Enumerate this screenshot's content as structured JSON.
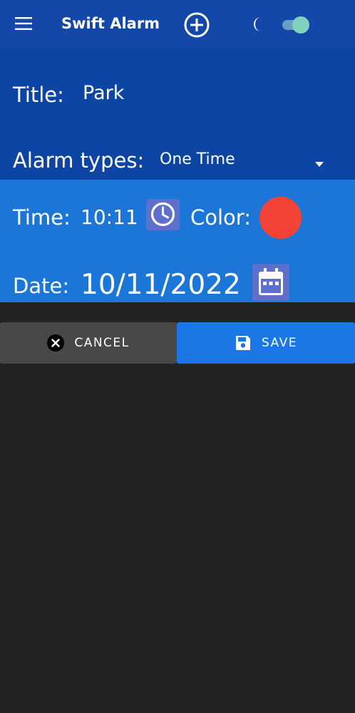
{
  "app_bar": {
    "title": "Swift Alarm",
    "menu_icon": "hamburger-menu-icon",
    "add_icon": "add-circle-icon",
    "theme_icon": "moon-icon",
    "dark_mode_enabled": true,
    "background_color": "#1347a8"
  },
  "form": {
    "title_label": "Title:",
    "title_value": "Park",
    "alarm_type_label": "Alarm types:",
    "alarm_type_value": "One Time",
    "time_label": "Time:",
    "time_value": "10:11",
    "color_label": "Color:",
    "color_value": "#f44336",
    "date_label": "Date:",
    "date_value": "10/11/2022"
  },
  "actions": {
    "cancel_label": "CANCEL",
    "save_label": "SAVE",
    "cancel_icon": "close-circle-icon",
    "save_icon": "floppy-disk-icon"
  },
  "colors": {
    "top_section": "#0d45a4",
    "mid_section": "#1b76d8",
    "icon_button": "#5e6fce",
    "save_button": "#1b76e6",
    "cancel_button": "#484848",
    "background": "#232323",
    "toggle_thumb": "#7fd3bd"
  }
}
